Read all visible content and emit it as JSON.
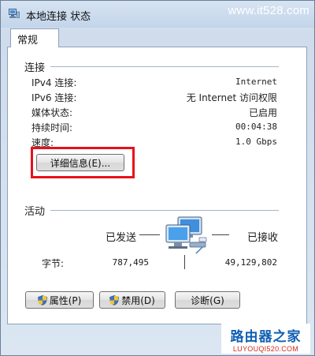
{
  "window": {
    "title": "本地连接 状态",
    "watermark_top": "www.it528.com"
  },
  "tabs": [
    {
      "label": "常规"
    }
  ],
  "connection": {
    "section_title": "连接",
    "rows": [
      {
        "label": "IPv4 连接:",
        "value": "Internet"
      },
      {
        "label": "IPv6 连接:",
        "value": "无 Internet 访问权限"
      },
      {
        "label": "媒体状态:",
        "value": "已启用"
      },
      {
        "label": "持续时间:",
        "value": "00:04:38"
      },
      {
        "label": "速度:",
        "value": "1.0 Gbps"
      }
    ],
    "details_button": "详细信息(E)..."
  },
  "activity": {
    "section_title": "活动",
    "sent_label": "已发送",
    "received_label": "已接收",
    "bytes_label": "字节:",
    "bytes_sent": "787,495",
    "bytes_received": "49,129,802"
  },
  "buttons": {
    "properties": "属性(P)",
    "disable": "禁用(D)",
    "diagnose": "诊断(G)"
  },
  "watermark_bottom": {
    "main": "路由器之家",
    "sub": "LUYOUQI520.COM"
  },
  "colors": {
    "highlight_border": "#e8111a",
    "watermark_blue": "#0f5fb3"
  }
}
